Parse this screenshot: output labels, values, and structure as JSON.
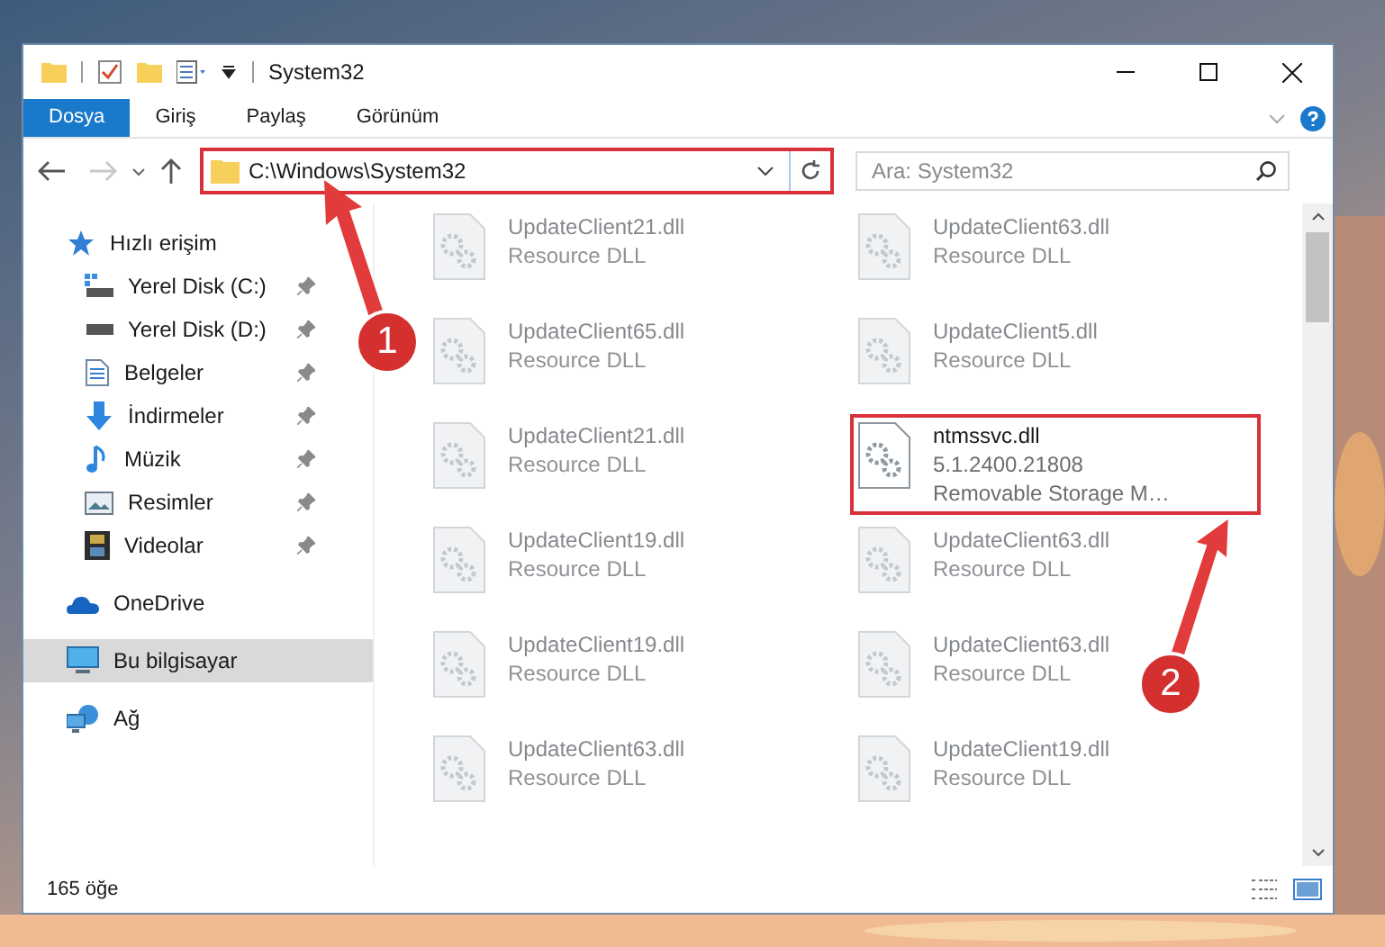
{
  "window": {
    "title": "System32"
  },
  "ribbon_tabs": [
    {
      "label": "Dosya",
      "selected": true
    },
    {
      "label": "Giriş",
      "selected": false
    },
    {
      "label": "Paylaş",
      "selected": false
    },
    {
      "label": "Görünüm",
      "selected": false
    }
  ],
  "address": {
    "value": "C:\\Windows\\System32"
  },
  "search": {
    "placeholder": "Ara: System32"
  },
  "nav": [
    {
      "label": "Hızlı erişim",
      "kind": "star",
      "selected": false,
      "children": [
        {
          "label": "Yerel Disk (C:)",
          "kind": "drive-c",
          "pinned": true,
          "selected": false
        },
        {
          "label": "Yerel Disk (D:)",
          "kind": "drive",
          "pinned": true,
          "selected": false
        },
        {
          "label": "Belgeler",
          "kind": "docs",
          "pinned": true,
          "selected": false
        },
        {
          "label": "İndirmeler",
          "kind": "download",
          "pinned": true,
          "selected": false
        },
        {
          "label": "Müzik",
          "kind": "music",
          "pinned": true,
          "selected": false
        },
        {
          "label": "Resimler",
          "kind": "pictures",
          "pinned": true,
          "selected": false
        },
        {
          "label": "Videolar",
          "kind": "videos",
          "pinned": true,
          "selected": false
        }
      ]
    },
    {
      "label": "OneDrive",
      "kind": "cloud",
      "selected": false
    },
    {
      "label": "Bu bilgisayar",
      "kind": "pc",
      "selected": true
    },
    {
      "label": "Ağ",
      "kind": "network",
      "selected": false
    }
  ],
  "files": [
    {
      "name": "UpdateClient21.dll",
      "lines": [
        "Resource DLL"
      ],
      "highlighted": false
    },
    {
      "name": "UpdateClient63.dll",
      "lines": [
        "Resource DLL"
      ],
      "highlighted": false
    },
    {
      "name": "UpdateClient65.dll",
      "lines": [
        "Resource DLL"
      ],
      "highlighted": false
    },
    {
      "name": "UpdateClient5.dll",
      "lines": [
        "Resource DLL"
      ],
      "highlighted": false
    },
    {
      "name": "UpdateClient21.dll",
      "lines": [
        "Resource DLL"
      ],
      "highlighted": false
    },
    {
      "name": "ntmssvc.dll",
      "lines": [
        "5.1.2400.21808",
        "Removable Storage M…"
      ],
      "highlighted": true
    },
    {
      "name": "UpdateClient19.dll",
      "lines": [
        "Resource DLL"
      ],
      "highlighted": false
    },
    {
      "name": "UpdateClient63.dll",
      "lines": [
        "Resource DLL"
      ],
      "highlighted": false
    },
    {
      "name": "UpdateClient19.dll",
      "lines": [
        "Resource DLL"
      ],
      "highlighted": false
    },
    {
      "name": "UpdateClient63.dll",
      "lines": [
        "Resource DLL"
      ],
      "highlighted": false
    },
    {
      "name": "UpdateClient63.dll",
      "lines": [
        "Resource DLL"
      ],
      "highlighted": false
    },
    {
      "name": "UpdateClient19.dll",
      "lines": [
        "Resource DLL"
      ],
      "highlighted": false
    }
  ],
  "status_bar": {
    "count": "165 öğe"
  },
  "annotations": [
    {
      "label": "1"
    },
    {
      "label": "2"
    }
  ]
}
